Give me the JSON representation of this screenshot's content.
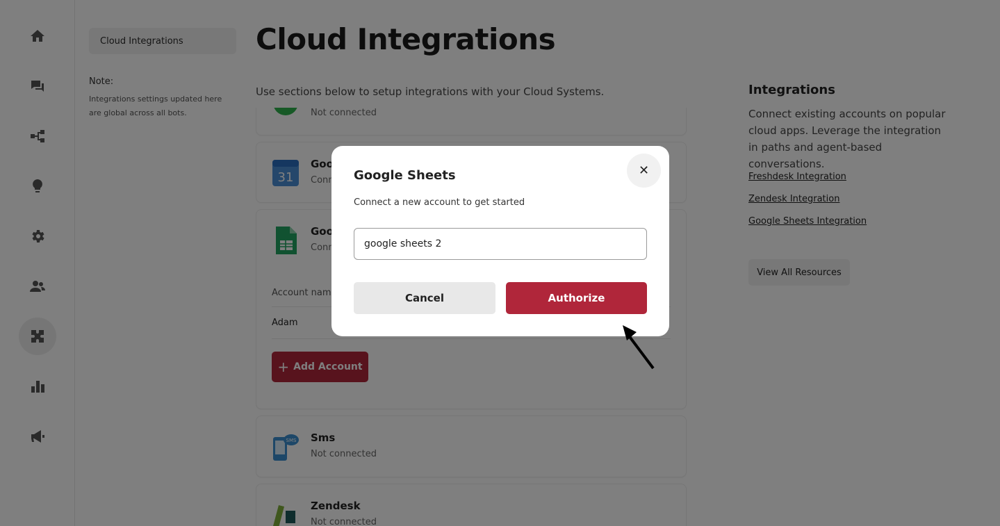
{
  "nav": {
    "items": [
      {
        "name": "home-icon"
      },
      {
        "name": "chat-icon"
      },
      {
        "name": "flow-icon"
      },
      {
        "name": "lightbulb-icon"
      },
      {
        "name": "gear-icon"
      },
      {
        "name": "users-icon"
      },
      {
        "name": "puzzle-icon",
        "active": true
      },
      {
        "name": "bar-chart-icon"
      },
      {
        "name": "megaphone-icon"
      }
    ]
  },
  "subnav": {
    "item": "Cloud Integrations",
    "note_title": "Note:",
    "note_text": "Integrations settings updated here are global across all bots."
  },
  "main": {
    "title": "Cloud Integrations",
    "subtitle": "Use sections below to setup integrations with your Cloud Systems.",
    "cards": [
      {
        "name": "",
        "status": "Not connected",
        "icon": "green-circle-icon"
      },
      {
        "name": "Goo",
        "status": "Conn",
        "icon": "google-calendar-icon",
        "calendar_day": "31"
      },
      {
        "name": "Goo",
        "status": "Conn",
        "icon": "google-sheets-icon"
      },
      {
        "name": "Sms",
        "status": "Not connected",
        "icon": "sms-icon"
      },
      {
        "name": "Zendesk",
        "status": "Not connected",
        "icon": "zendesk-icon"
      }
    ],
    "accounts": {
      "header": "Account name",
      "rows": [
        "Adam"
      ],
      "add_button": "Add Account"
    }
  },
  "right": {
    "title": "Integrations",
    "text": "Connect existing accounts on popular cloud apps. Leverage the integration in paths and agent-based conversations.",
    "links": [
      "Freshdesk Integration",
      "Zendesk Integration",
      "Google Sheets Integration"
    ],
    "button": "View All Resources"
  },
  "modal": {
    "title": "Google Sheets",
    "subtitle": "Connect a new account to get started",
    "input_value": "google sheets 2",
    "close_symbol": "✕",
    "cancel_label": "Cancel",
    "authorize_label": "Authorize"
  },
  "colors": {
    "accent": "#b0263a",
    "overlay": "rgba(0,0,0,0.5)"
  }
}
